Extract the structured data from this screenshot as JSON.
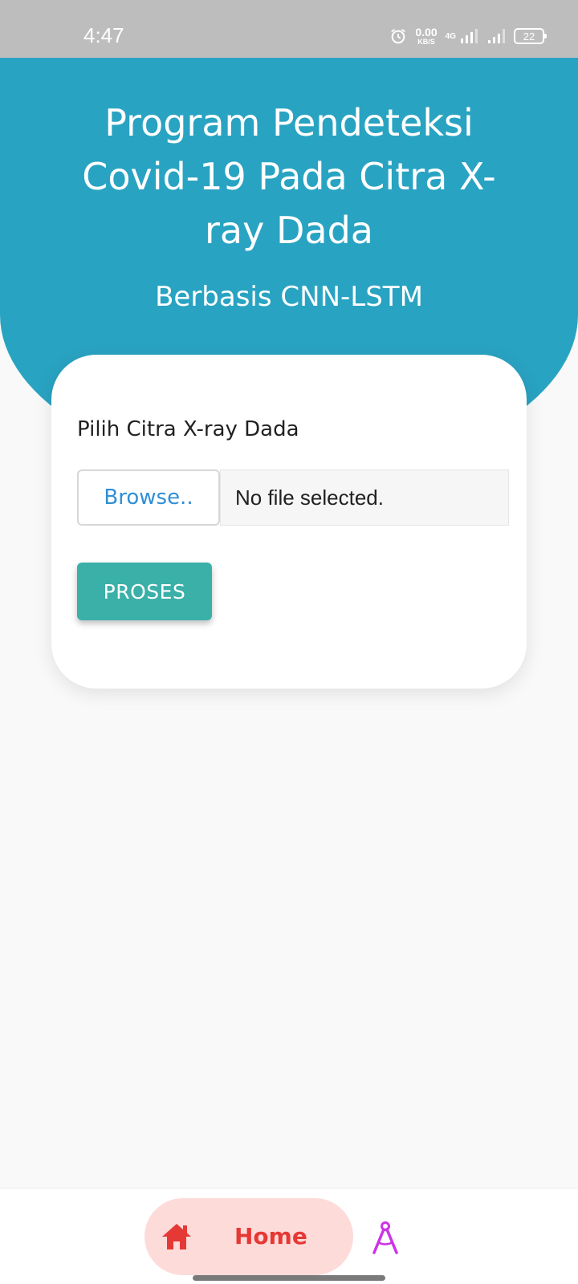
{
  "status_bar": {
    "time": "4:47",
    "net_speed_value": "0.00",
    "net_speed_unit": "KB/S",
    "network_type": "4G",
    "battery_level": "22"
  },
  "header": {
    "title": "Program Pendeteksi Covid-19 Pada Citra X-ray Dada",
    "subtitle": "Berbasis CNN-LSTM"
  },
  "form": {
    "label": "Pilih Citra X-ray Dada",
    "browse_label": "Browse..",
    "file_status": "No file selected.",
    "submit_label": "PROSES"
  },
  "bottom_nav": {
    "items": [
      {
        "label": "Home",
        "icon": "home-icon",
        "active": true
      },
      {
        "label": "",
        "icon": "compass-icon",
        "active": false
      }
    ]
  },
  "colors": {
    "header_bg": "#29a3c2",
    "button_teal": "#3ab0a8",
    "browse_text": "#2f8fd6",
    "nav_active_bg": "#fddbd9",
    "nav_active_fg": "#e53935",
    "compass": "#cc33e6"
  }
}
